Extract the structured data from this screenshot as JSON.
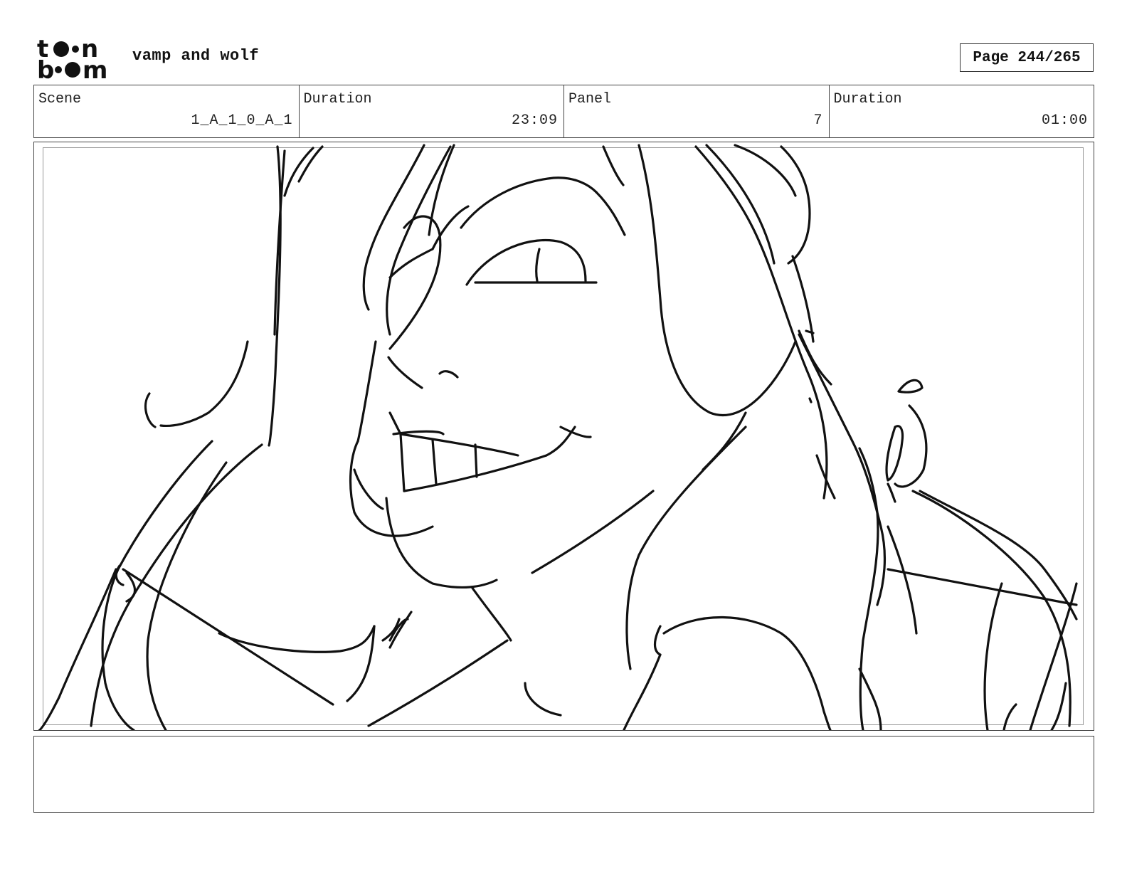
{
  "header": {
    "logo_text": "toon boom",
    "project_title": "vamp and wolf",
    "page_label": "Page 244/265"
  },
  "info": {
    "scene_label": "Scene",
    "scene_value": "1_A_1_0_A_1",
    "duration_label": "Duration",
    "duration_value": "23:09",
    "panel_label": "Panel",
    "panel_value": "7",
    "panel_duration_label": "Duration",
    "panel_duration_value": "01:00"
  },
  "notes": {
    "text": ""
  }
}
